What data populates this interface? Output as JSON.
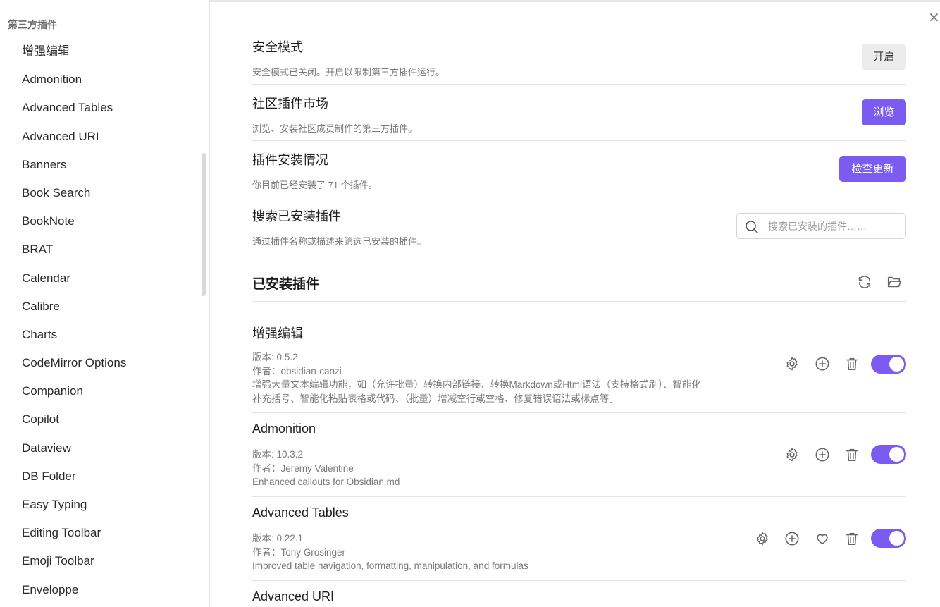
{
  "sidebar": {
    "heading": "第三方插件",
    "items": [
      "增强编辑",
      "Admonition",
      "Advanced Tables",
      "Advanced URI",
      "Banners",
      "Book Search",
      "BookNote",
      "BRAT",
      "Calendar",
      "Calibre",
      "Charts",
      "CodeMirror Options",
      "Companion",
      "Copilot",
      "Dataview",
      "DB Folder",
      "Easy Typing",
      "Editing Toolbar",
      "Emoji Toolbar",
      "Enveloppe"
    ]
  },
  "close_icon": "×",
  "settings": {
    "safe_mode": {
      "name": "安全模式",
      "desc": "安全模式已关闭。开启以限制第三方插件运行。",
      "button": "开启"
    },
    "market": {
      "name": "社区插件市场",
      "desc": "浏览、安装社区成员制作的第三方插件。",
      "button": "浏览"
    },
    "install_status": {
      "name": "插件安装情况",
      "desc": "你目前已经安装了 71 个插件。",
      "button": "检查更新"
    },
    "search": {
      "name": "搜索已安装插件",
      "desc": "通过插件名称或描述来筛选已安装的插件。",
      "placeholder": "搜索已安装的插件……"
    }
  },
  "installed": {
    "title": "已安装插件",
    "icons": [
      "refresh-icon",
      "folder-open-icon"
    ],
    "plugins": [
      {
        "name": "增强编辑",
        "version": "版本: 0.5.2",
        "author": "作者：obsidian-canzi",
        "desc_line1": "增强大量文本编辑功能，如（允许批量）转换内部链接、转换Markdown或Html语法（支持格式刷）、智能化",
        "desc_line2": "补充括号、智能化粘贴表格或代码、（批量）增减空行或空格、修复错误语法或标点等。",
        "enabled": true
      },
      {
        "name": "Admonition",
        "version": "版本: 10.3.2",
        "author": "作者：Jeremy Valentine",
        "desc_line1": "Enhanced callouts for Obsidian.md",
        "enabled": true
      },
      {
        "name": "Advanced Tables",
        "version": "版本: 0.22.1",
        "author": "作者：Tony Grosinger",
        "desc_line1": "Improved table navigation, formatting, manipulation, and formulas",
        "enabled": true
      },
      {
        "name": "Advanced URI"
      }
    ]
  },
  "colors": {
    "accent": "#7c5cf0",
    "muted_text": "#7a7a7a",
    "divider": "#e4e4e4"
  }
}
